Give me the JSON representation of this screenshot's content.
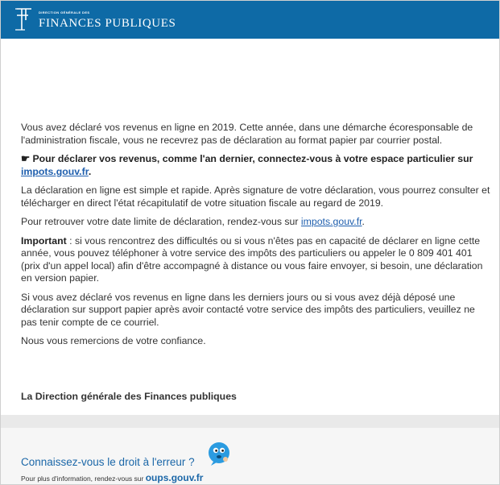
{
  "header": {
    "logo_small": "DIRECTION GÉNÉRALE DES",
    "logo_big": "FINANCES PUBLIQUES"
  },
  "body": {
    "p1": "Vous avez déclaré vos revenus en ligne en 2019. Cette année, dans une démarche écoresponsable de l'administration fiscale, vous ne recevrez pas de déclaration au format papier par courrier postal.",
    "p2_icon": "☛",
    "p2_bold": " Pour déclarer vos revenus, comme l'an dernier, connectez-vous à votre espace particulier sur ",
    "p2_link": "impots.gouv.fr",
    "p2_end": ".",
    "p3": "La déclaration en ligne est simple et rapide. Après signature de votre déclaration, vous pourrez consulter et télécharger en direct l'état récapitulatif de votre situation fiscale au regard de 2019.",
    "p4_text": "Pour retrouver votre date limite de déclaration, rendez-vous sur ",
    "p4_link": "impots.gouv.fr",
    "p4_end": ".",
    "p5_bold": "Important",
    "p5_text": " : si vous rencontrez des difficultés ou si vous n'êtes pas en capacité de déclarer en ligne cette année, vous pouvez téléphoner à votre service des impôts des particuliers ou appeler le 0 809 401 401 (prix d'un appel local) afin d'être accompagné à distance ou vous faire envoyer, si besoin, une déclaration en version papier.",
    "p6": "Si vous avez déclaré vos revenus en ligne dans les derniers jours ou si vous avez déjà déposé une déclaration sur support papier après avoir contacté votre service des impôts des particuliers, veuillez ne pas tenir compte de ce courriel.",
    "p7": "Nous vous remercions de votre confiance.",
    "signature": "La Direction générale des Finances publiques"
  },
  "footer": {
    "title": "Connaissez-vous le droit à l'erreur ?",
    "info_text": "Pour plus d'information, rendez-vous sur ",
    "info_link": "oups.gouv.fr"
  },
  "colors": {
    "header_bg": "#0e6aa6",
    "link": "#1f5fae",
    "footer_title": "#1b67a8"
  }
}
